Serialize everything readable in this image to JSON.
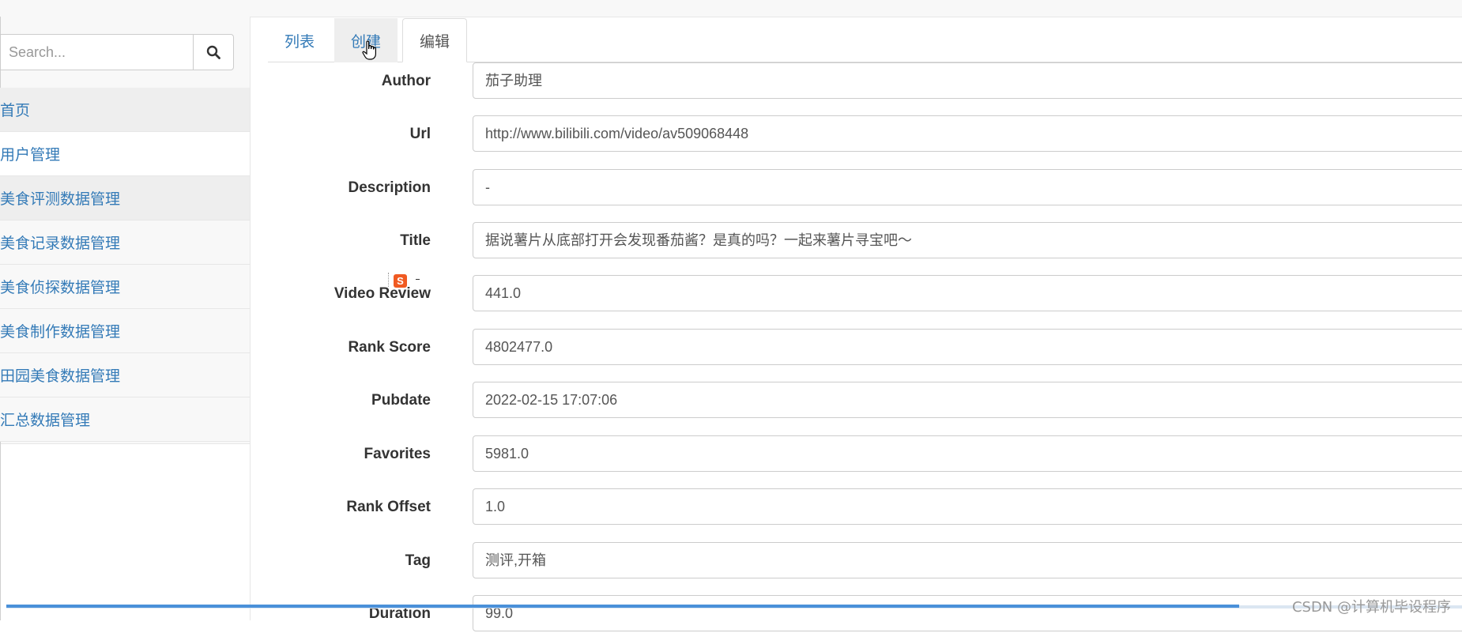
{
  "search": {
    "placeholder": "Search..."
  },
  "sidebar": {
    "items": [
      {
        "label": "首页"
      },
      {
        "label": "用户管理"
      },
      {
        "label": "美食评测数据管理"
      },
      {
        "label": "美食记录数据管理"
      },
      {
        "label": "美食侦探数据管理"
      },
      {
        "label": "美食制作数据管理"
      },
      {
        "label": "田园美食数据管理"
      },
      {
        "label": "汇总数据管理"
      }
    ]
  },
  "tabs": [
    {
      "label": "列表"
    },
    {
      "label": "创建"
    },
    {
      "label": "编辑"
    }
  ],
  "form": {
    "fields": [
      {
        "label": "Author",
        "value": "茄子助理"
      },
      {
        "label": "Url",
        "value": "http://www.bilibili.com/video/av509068448"
      },
      {
        "label": "Description",
        "value": "-"
      },
      {
        "label": "Title",
        "value": "据说薯片从底部打开会发现番茄酱？是真的吗？一起来薯片寻宝吧～"
      },
      {
        "label": "Video Review",
        "value": "441.0"
      },
      {
        "label": "Rank Score",
        "value": "4802477.0"
      },
      {
        "label": "Pubdate",
        "value": "2022-02-15 17:07:06"
      },
      {
        "label": "Favorites",
        "value": "5981.0"
      },
      {
        "label": "Rank Offset",
        "value": "1.0"
      },
      {
        "label": "Tag",
        "value": "测评,开箱"
      },
      {
        "label": "Duration",
        "value": "99.0"
      }
    ]
  },
  "overlay": {
    "s_icon": "S"
  },
  "watermark": "CSDN @计算机毕设程序"
}
